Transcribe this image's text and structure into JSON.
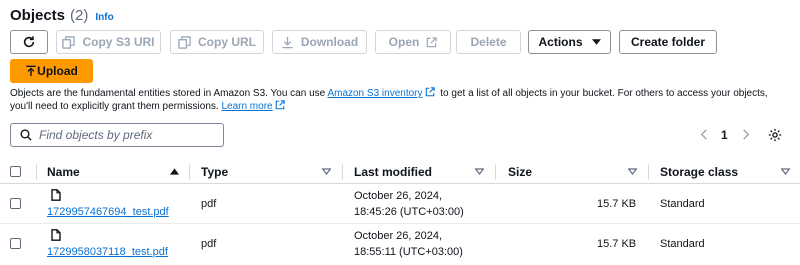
{
  "header": {
    "title": "Objects",
    "count": "(2)",
    "info": "Info"
  },
  "toolbar": {
    "refresh": "refresh-icon",
    "copy_s3_uri": "Copy S3 URI",
    "copy_url": "Copy URL",
    "download": "Download",
    "open": "Open",
    "delete": "Delete",
    "actions": "Actions",
    "create_folder": "Create folder",
    "upload": "Upload"
  },
  "description": {
    "part1": "Objects are the fundamental entities stored in Amazon S3. You can use ",
    "link_inventory": "Amazon S3 inventory",
    "part2": " to get a list of all objects in your bucket. For others to access your objects, you'll need to explicitly grant them permissions. ",
    "link_learn": "Learn more"
  },
  "search": {
    "placeholder": "Find objects by prefix"
  },
  "pagination": {
    "page": "1"
  },
  "table": {
    "columns": [
      "Name",
      "Type",
      "Last modified",
      "Size",
      "Storage class"
    ],
    "rows": [
      {
        "name": "1729957467694_test.pdf",
        "type": "pdf",
        "modified_date": "October 26, 2024,",
        "modified_time": "18:45:26 (UTC+03:00)",
        "size": "15.7 KB",
        "storage": "Standard"
      },
      {
        "name": "1729958037118_test.pdf",
        "type": "pdf",
        "modified_date": "October 26, 2024,",
        "modified_time": "18:55:11 (UTC+03:00)",
        "size": "15.7 KB",
        "storage": "Standard"
      }
    ]
  },
  "colors": {
    "accent": "#0972d3",
    "upload": "#ff9900",
    "border": "#8d9096"
  }
}
